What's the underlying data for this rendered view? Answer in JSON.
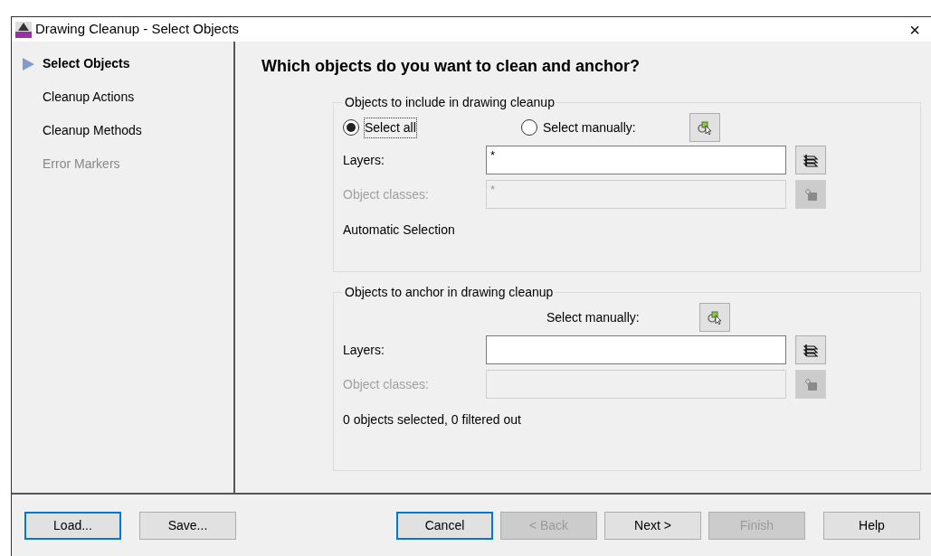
{
  "window": {
    "title": "Drawing Cleanup - Select Objects",
    "close": "×"
  },
  "steps": [
    {
      "label": "Select Objects",
      "selected": true,
      "disabled": false
    },
    {
      "label": "Cleanup Actions",
      "selected": false,
      "disabled": false
    },
    {
      "label": "Cleanup Methods",
      "selected": false,
      "disabled": false
    },
    {
      "label": "Error Markers",
      "selected": false,
      "disabled": true
    }
  ],
  "heading": "Which objects do you want to clean and anchor?",
  "include_group": {
    "title": "Objects to include in drawing cleanup",
    "options": [
      {
        "label": "Select all",
        "selected": true
      },
      {
        "label": "Select manually:",
        "selected": false
      }
    ],
    "fields": [
      {
        "label": "Layers:",
        "value": "*",
        "disabled": false
      },
      {
        "label": "Object classes:",
        "value": "*",
        "disabled": true
      }
    ],
    "note": "Automatic Selection"
  },
  "anchor_group": {
    "title": "Objects to anchor in drawing cleanup",
    "select_label": "Select manually:",
    "fields": [
      {
        "label": "Layers:",
        "disabled": false
      },
      {
        "label": "Object classes:",
        "disabled": true
      }
    ],
    "note": "0 objects selected, 0 filtered out"
  },
  "left_buttons": [
    {
      "label": "Load...",
      "focused": true,
      "disabled": false
    },
    {
      "label": "Save...",
      "focused": false,
      "disabled": false
    }
  ],
  "right_buttons": [
    {
      "label": "Cancel",
      "focused": true,
      "disabled": false
    },
    {
      "label": "< Back",
      "focused": false,
      "disabled": true
    },
    {
      "label": "Next >",
      "focused": false,
      "disabled": false
    },
    {
      "label": "Finish",
      "focused": false,
      "disabled": true
    },
    {
      "label": "Help",
      "focused": false,
      "disabled": false
    }
  ]
}
